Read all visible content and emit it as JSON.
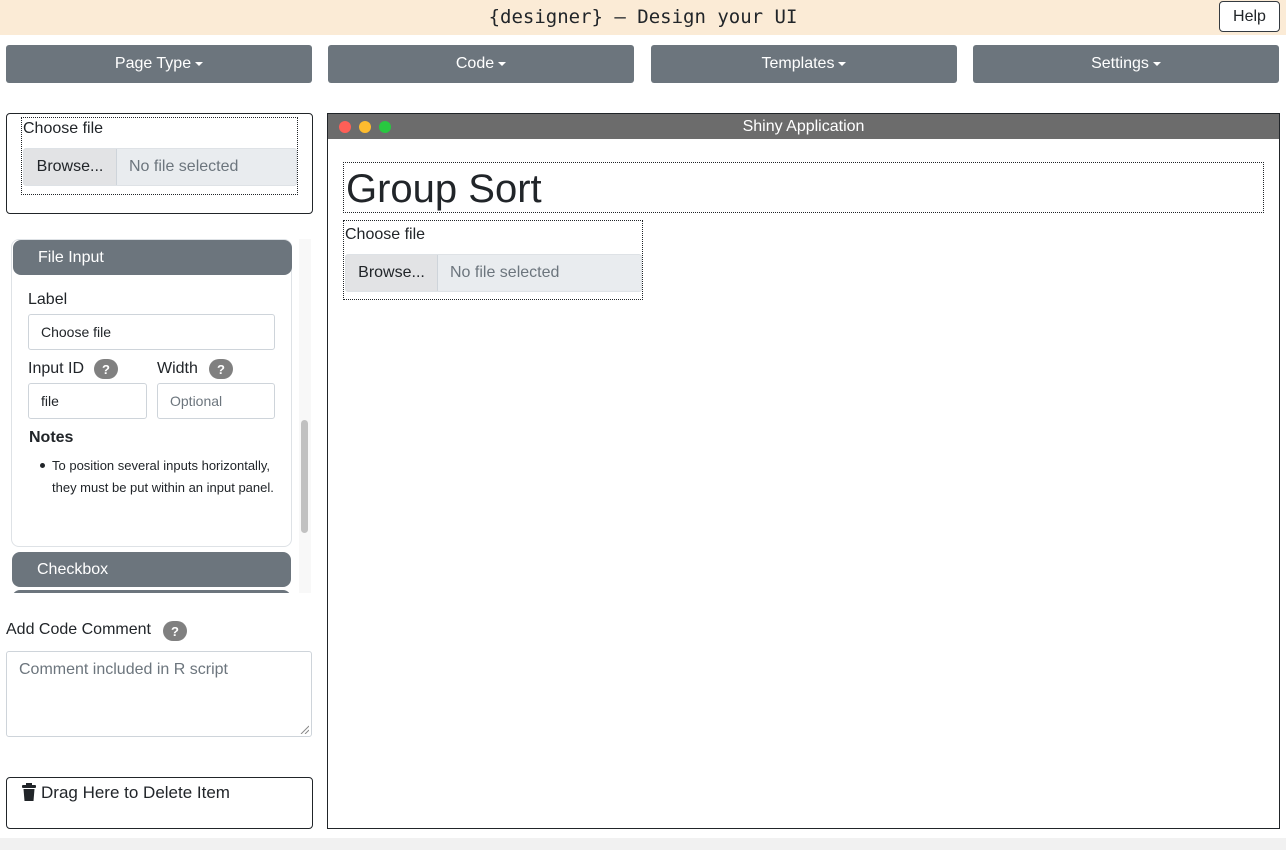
{
  "header": {
    "title": "{designer} – Design your UI",
    "help_label": "Help"
  },
  "menu": {
    "items": [
      {
        "label": "Page Type"
      },
      {
        "label": "Code"
      },
      {
        "label": "Templates"
      },
      {
        "label": "Settings"
      }
    ]
  },
  "component_preview": {
    "label": "Choose file",
    "browse_label": "Browse...",
    "status": "No file selected"
  },
  "accordion": {
    "items": [
      {
        "label": "File Input"
      },
      {
        "label": "Checkbox"
      }
    ],
    "file_input": {
      "label_field": {
        "label": "Label",
        "value": "Choose file"
      },
      "input_id_field": {
        "label": "Input ID",
        "value": "file"
      },
      "width_field": {
        "label": "Width",
        "placeholder": "Optional"
      },
      "help_glyph": "?",
      "notes_title": "Notes",
      "notes": [
        "To position several inputs horizontally, they must be put within an input panel."
      ]
    },
    "scroll_fraction": 0.51
  },
  "code_comment": {
    "label": "Add Code Comment",
    "help_glyph": "?",
    "placeholder": "Comment included in R script"
  },
  "delete_zone": {
    "label": "Drag Here to Delete Item",
    "icon": "trash-icon"
  },
  "app_window": {
    "title": "Shiny Application",
    "heading": "Group Sort",
    "file_input": {
      "label": "Choose file",
      "browse_label": "Browse...",
      "status": "No file selected"
    }
  },
  "colors": {
    "topbar": "#fbebd6",
    "menu_button": "#6c757d",
    "window_titlebar": "#6c6c6c",
    "dot_close": "#ff5f57",
    "dot_minimize": "#febc2e",
    "dot_maximize": "#28c840"
  }
}
